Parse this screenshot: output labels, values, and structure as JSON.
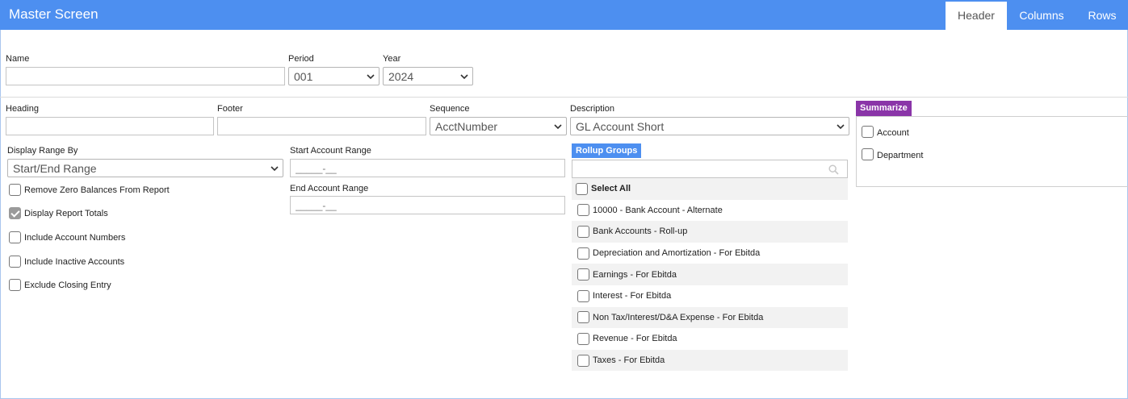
{
  "app": {
    "title": "Master Screen"
  },
  "tabs": [
    {
      "label": "Header",
      "active": true
    },
    {
      "label": "Columns",
      "active": false
    },
    {
      "label": "Rows",
      "active": false
    }
  ],
  "top_fields": {
    "name": {
      "label": "Name",
      "value": ""
    },
    "period": {
      "label": "Period",
      "value": "001"
    },
    "year": {
      "label": "Year",
      "value": "2024"
    }
  },
  "report_fields": {
    "heading": {
      "label": "Heading",
      "value": ""
    },
    "footer": {
      "label": "Footer",
      "value": ""
    },
    "sequence": {
      "label": "Sequence",
      "value": "AcctNumber"
    },
    "description": {
      "label": "Description",
      "value": "GL Account Short"
    }
  },
  "display_range": {
    "label": "Display Range By",
    "value": "Start/End Range"
  },
  "account_range": {
    "start_label": "Start Account Range",
    "start_placeholder": "_____-__",
    "end_label": "End Account Range",
    "end_placeholder": "_____-__"
  },
  "options": [
    {
      "label": "Remove Zero Balances From Report",
      "checked": false
    },
    {
      "label": "Display Report Totals",
      "checked": true
    },
    {
      "label": "Include Account Numbers",
      "checked": false
    },
    {
      "label": "Include Inactive Accounts",
      "checked": false
    },
    {
      "label": "Exclude Closing Entry",
      "checked": false
    }
  ],
  "rollup": {
    "title": "Rollup Groups",
    "search_placeholder": "",
    "select_all": "Select All",
    "items": [
      {
        "label": "10000 - Bank Account - Alternate",
        "checked": false
      },
      {
        "label": "Bank Accounts - Roll-up",
        "checked": false
      },
      {
        "label": "Depreciation and Amortization - For Ebitda",
        "checked": false
      },
      {
        "label": "Earnings - For Ebitda",
        "checked": false
      },
      {
        "label": "Interest - For Ebitda",
        "checked": false
      },
      {
        "label": "Non Tax/Interest/D&A Expense - For Ebitda",
        "checked": false
      },
      {
        "label": "Revenue - For Ebitda",
        "checked": false
      },
      {
        "label": "Taxes - For Ebitda",
        "checked": false
      }
    ]
  },
  "summarize": {
    "title": "Summarize",
    "account": {
      "label": "Account",
      "checked": false
    },
    "department": {
      "label": "Department",
      "checked": false
    }
  },
  "colors": {
    "accent": "#4d8ff0",
    "summarize": "#8a35a8"
  },
  "icons": {
    "dropdown": "chevron-down-icon",
    "search": "search-icon",
    "check": "checkmark-icon"
  }
}
